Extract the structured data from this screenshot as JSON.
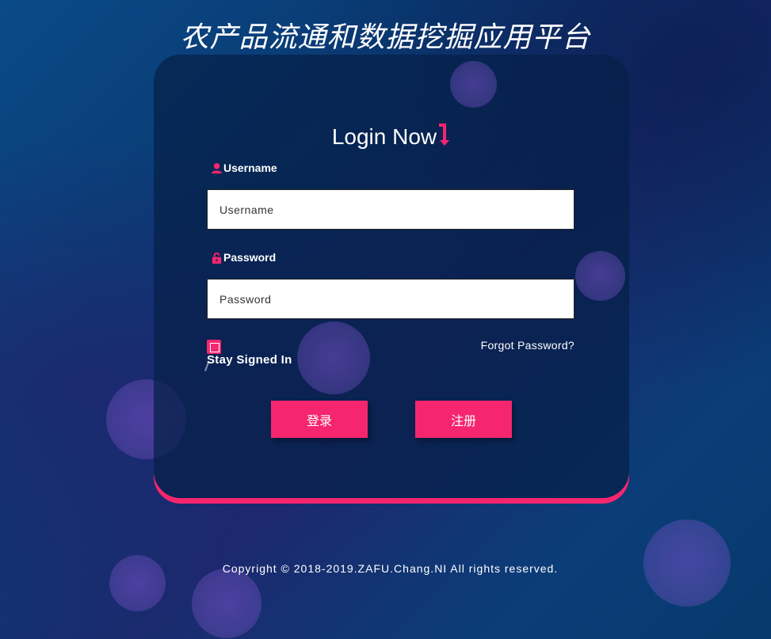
{
  "page": {
    "title": "农产品流通和数据挖掘应用平台"
  },
  "login": {
    "heading": "Login Now",
    "username": {
      "label": "Username",
      "placeholder": "Username",
      "value": ""
    },
    "password": {
      "label": "Password",
      "placeholder": "Password",
      "value": ""
    },
    "stay_signed_in": {
      "label": "Stay Signed In",
      "checked": false
    },
    "forgot_password": "Forgot Password?",
    "login_button": "登录",
    "register_button": "注册"
  },
  "footer": {
    "copyright": "Copyright © 2018-2019.ZAFU.Chang.NI All rights reserved."
  },
  "colors": {
    "accent": "#f6266e",
    "card_bg": "#06204a",
    "text": "#ffffff"
  },
  "icons": {
    "title_arrow": "arrow-down-right-icon",
    "username": "user-icon",
    "password": "unlock-icon"
  }
}
